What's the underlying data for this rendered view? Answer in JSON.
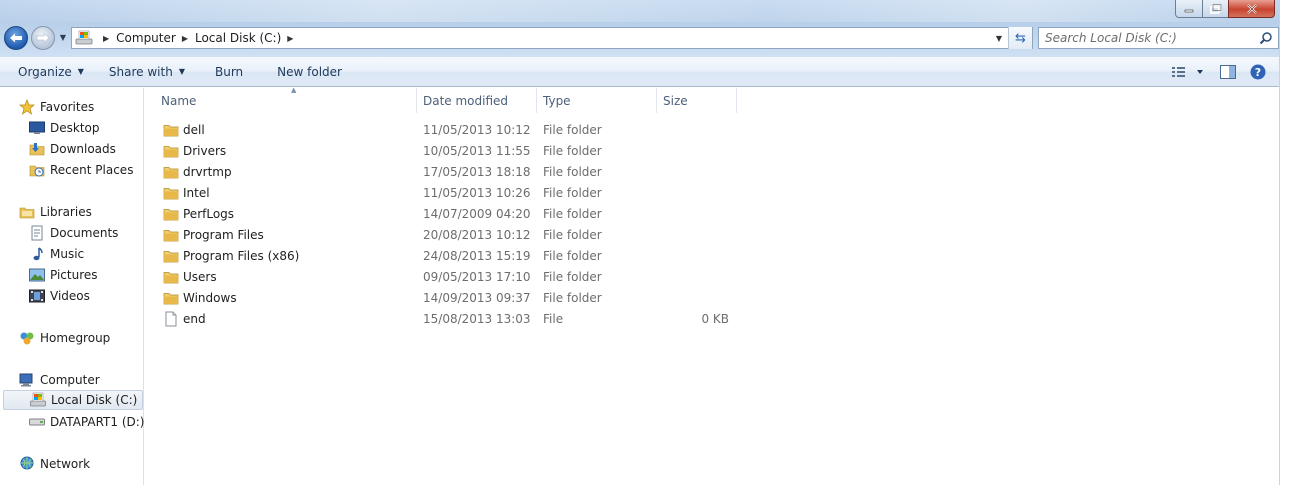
{
  "window": {
    "controls": {
      "minimize_icon": "minimize-icon",
      "maximize_icon": "restore-icon",
      "close_icon": "close-icon"
    }
  },
  "address": {
    "crumbs": [
      "Computer",
      "Local Disk (C:)"
    ]
  },
  "search": {
    "placeholder": "Search Local Disk (C:)"
  },
  "toolbar": {
    "organize": "Organize",
    "share_with": "Share with",
    "burn": "Burn",
    "new_folder": "New folder"
  },
  "nav": {
    "favorites": "Favorites",
    "desktop": "Desktop",
    "downloads": "Downloads",
    "recent_places": "Recent Places",
    "libraries": "Libraries",
    "documents": "Documents",
    "music": "Music",
    "pictures": "Pictures",
    "videos": "Videos",
    "homegroup": "Homegroup",
    "computer": "Computer",
    "local_disk": "Local Disk (C:)",
    "datapart": "DATAPART1 (D:)",
    "network": "Network"
  },
  "columns": {
    "name": "Name",
    "date": "Date modified",
    "type": "Type",
    "size": "Size"
  },
  "files": [
    {
      "name": "dell",
      "date": "11/05/2013 10:12",
      "type": "File folder",
      "size": "",
      "icon": "folder"
    },
    {
      "name": "Drivers",
      "date": "10/05/2013 11:55",
      "type": "File folder",
      "size": "",
      "icon": "folder"
    },
    {
      "name": "drvrtmp",
      "date": "17/05/2013 18:18",
      "type": "File folder",
      "size": "",
      "icon": "folder"
    },
    {
      "name": "Intel",
      "date": "11/05/2013 10:26",
      "type": "File folder",
      "size": "",
      "icon": "folder"
    },
    {
      "name": "PerfLogs",
      "date": "14/07/2009 04:20",
      "type": "File folder",
      "size": "",
      "icon": "folder"
    },
    {
      "name": "Program Files",
      "date": "20/08/2013 10:12",
      "type": "File folder",
      "size": "",
      "icon": "folder"
    },
    {
      "name": "Program Files (x86)",
      "date": "24/08/2013 15:19",
      "type": "File folder",
      "size": "",
      "icon": "folder"
    },
    {
      "name": "Users",
      "date": "09/05/2013 17:10",
      "type": "File folder",
      "size": "",
      "icon": "folder"
    },
    {
      "name": "Windows",
      "date": "14/09/2013 09:37",
      "type": "File folder",
      "size": "",
      "icon": "folder"
    },
    {
      "name": "end",
      "date": "15/08/2013 13:03",
      "type": "File",
      "size": "0 KB",
      "icon": "file"
    }
  ],
  "colors": {
    "folder": "#e8c15a",
    "accent": "#2c67b5",
    "selected_bg": "#e1e8f1"
  }
}
